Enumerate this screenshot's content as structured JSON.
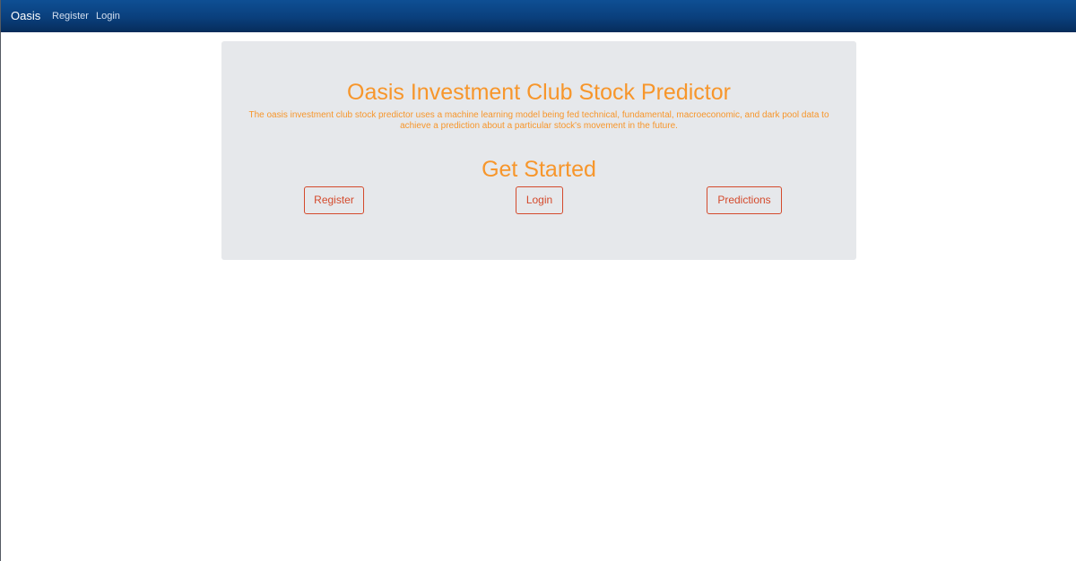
{
  "navbar": {
    "brand": "Oasis",
    "links": [
      "Register",
      "Login"
    ]
  },
  "hero": {
    "title": "Oasis Investment Club Stock Predictor",
    "description": "The oasis investment club stock predictor uses a machine learning model being fed technical, fundamental, macroeconomic, and dark pool data to achieve a prediction about a particular stock's movement in the future."
  },
  "get_started": {
    "title": "Get Started",
    "buttons": [
      "Register",
      "Login",
      "Predictions"
    ]
  },
  "colors": {
    "navbar": "#0a3f7c",
    "jumbotron": "#e6e8eb",
    "accent_orange": "#f7962b",
    "button_outline": "#d44a2c"
  }
}
